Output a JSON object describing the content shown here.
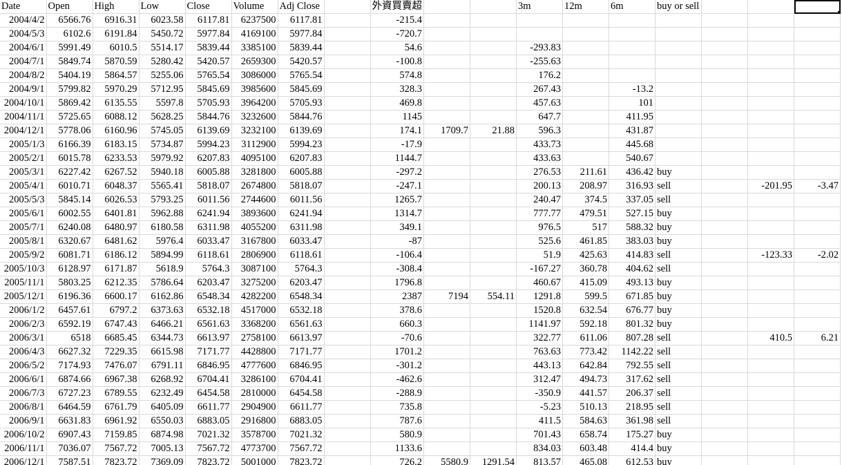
{
  "sheet": {
    "headers": [
      "Date",
      "Open",
      "High",
      "Low",
      "Close",
      "Volume",
      "Adj Close",
      "",
      "外資買賣超",
      "",
      "",
      "3m",
      "12m",
      "6m",
      "buy or sell",
      "",
      "",
      ""
    ],
    "rows": [
      [
        "2004/4/2",
        "6566.76",
        "6916.31",
        "6023.58",
        "6117.81",
        "6237500",
        "6117.81",
        "",
        "-215.4",
        "",
        "",
        "",
        "",
        "",
        "",
        "",
        "",
        ""
      ],
      [
        "2004/5/3",
        "6102.6",
        "6191.84",
        "5450.72",
        "5977.84",
        "4169100",
        "5977.84",
        "",
        "-720.7",
        "",
        "",
        "",
        "",
        "",
        "",
        "",
        "",
        ""
      ],
      [
        "2004/6/1",
        "5991.49",
        "6010.5",
        "5514.17",
        "5839.44",
        "3385100",
        "5839.44",
        "",
        "54.6",
        "",
        "",
        "-293.83",
        "",
        "",
        "",
        "",
        "",
        ""
      ],
      [
        "2004/7/1",
        "5849.74",
        "5870.59",
        "5280.42",
        "5420.57",
        "2659300",
        "5420.57",
        "",
        "-100.8",
        "",
        "",
        "-255.63",
        "",
        "",
        "",
        "",
        "",
        ""
      ],
      [
        "2004/8/2",
        "5404.19",
        "5864.57",
        "5255.06",
        "5765.54",
        "3086000",
        "5765.54",
        "",
        "574.8",
        "",
        "",
        "176.2",
        "",
        "",
        "",
        "",
        "",
        ""
      ],
      [
        "2004/9/1",
        "5799.82",
        "5970.29",
        "5712.95",
        "5845.69",
        "3985600",
        "5845.69",
        "",
        "328.3",
        "",
        "",
        "267.43",
        "",
        "-13.2",
        "",
        "",
        "",
        ""
      ],
      [
        "2004/10/1",
        "5869.42",
        "6135.55",
        "5597.8",
        "5705.93",
        "3964200",
        "5705.93",
        "",
        "469.8",
        "",
        "",
        "457.63",
        "",
        "101",
        "",
        "",
        "",
        ""
      ],
      [
        "2004/11/1",
        "5725.65",
        "6088.12",
        "5628.25",
        "5844.76",
        "3232600",
        "5844.76",
        "",
        "1145",
        "",
        "",
        "647.7",
        "",
        "411.95",
        "",
        "",
        "",
        ""
      ],
      [
        "2004/12/1",
        "5778.06",
        "6160.96",
        "5745.05",
        "6139.69",
        "3232100",
        "6139.69",
        "",
        "174.1",
        "1709.7",
        "21.88",
        "596.3",
        "",
        "431.87",
        "",
        "",
        "",
        ""
      ],
      [
        "2005/1/3",
        "6166.39",
        "6183.15",
        "5734.87",
        "5994.23",
        "3112900",
        "5994.23",
        "",
        "-17.9",
        "",
        "",
        "433.73",
        "",
        "445.68",
        "",
        "",
        "",
        ""
      ],
      [
        "2005/2/1",
        "6015.78",
        "6233.53",
        "5979.92",
        "6207.83",
        "4095100",
        "6207.83",
        "",
        "1144.7",
        "",
        "",
        "433.63",
        "",
        "540.67",
        "",
        "",
        "",
        ""
      ],
      [
        "2005/3/1",
        "6227.42",
        "6267.52",
        "5940.18",
        "6005.88",
        "3281800",
        "6005.88",
        "",
        "-297.2",
        "",
        "",
        "276.53",
        "211.61",
        "436.42",
        "buy",
        "",
        "",
        ""
      ],
      [
        "2005/4/1",
        "6010.71",
        "6048.37",
        "5565.41",
        "5818.07",
        "2674800",
        "5818.07",
        "",
        "-247.1",
        "",
        "",
        "200.13",
        "208.97",
        "316.93",
        "sell",
        "",
        "-201.95",
        "-3.47"
      ],
      [
        "2005/5/3",
        "5845.14",
        "6026.53",
        "5793.25",
        "6011.56",
        "2744600",
        "6011.56",
        "",
        "1265.7",
        "",
        "",
        "240.47",
        "374.5",
        "337.05",
        "sell",
        "",
        "",
        ""
      ],
      [
        "2005/6/1",
        "6002.55",
        "6401.81",
        "5962.88",
        "6241.94",
        "3893600",
        "6241.94",
        "",
        "1314.7",
        "",
        "",
        "777.77",
        "479.51",
        "527.15",
        "buy",
        "",
        "",
        ""
      ],
      [
        "2005/7/1",
        "6240.08",
        "6480.97",
        "6180.58",
        "6311.98",
        "4055200",
        "6311.98",
        "",
        "349.1",
        "",
        "",
        "976.5",
        "517",
        "588.32",
        "buy",
        "",
        "",
        ""
      ],
      [
        "2005/8/1",
        "6320.67",
        "6481.62",
        "5976.4",
        "6033.47",
        "3167800",
        "6033.47",
        "",
        "-87",
        "",
        "",
        "525.6",
        "461.85",
        "383.03",
        "buy",
        "",
        "",
        ""
      ],
      [
        "2005/9/2",
        "6081.71",
        "6186.12",
        "5894.99",
        "6118.61",
        "2806900",
        "6118.61",
        "",
        "-106.4",
        "",
        "",
        "51.9",
        "425.63",
        "414.83",
        "sell",
        "",
        "-123.33",
        "-2.02"
      ],
      [
        "2005/10/3",
        "6128.97",
        "6171.87",
        "5618.9",
        "5764.3",
        "3087100",
        "5764.3",
        "",
        "-308.4",
        "",
        "",
        "-167.27",
        "360.78",
        "404.62",
        "sell",
        "",
        "",
        ""
      ],
      [
        "2005/11/1",
        "5803.25",
        "6212.35",
        "5786.64",
        "6203.47",
        "3275200",
        "6203.47",
        "",
        "1796.8",
        "",
        "",
        "460.67",
        "415.09",
        "493.13",
        "buy",
        "",
        "",
        ""
      ],
      [
        "2005/12/1",
        "6196.36",
        "6600.17",
        "6162.86",
        "6548.34",
        "4282200",
        "6548.34",
        "",
        "2387",
        "7194",
        "554.11",
        "1291.8",
        "599.5",
        "671.85",
        "buy",
        "",
        "",
        ""
      ],
      [
        "2006/1/2",
        "6457.61",
        "6797.2",
        "6373.63",
        "6532.18",
        "4517000",
        "6532.18",
        "",
        "378.6",
        "",
        "",
        "1520.8",
        "632.54",
        "676.77",
        "buy",
        "",
        "",
        ""
      ],
      [
        "2006/2/3",
        "6592.19",
        "6747.43",
        "6466.21",
        "6561.63",
        "3368200",
        "6561.63",
        "",
        "660.3",
        "",
        "",
        "1141.97",
        "592.18",
        "801.32",
        "buy",
        "",
        "",
        ""
      ],
      [
        "2006/3/1",
        "6518",
        "6685.45",
        "6344.73",
        "6613.97",
        "2758100",
        "6613.97",
        "",
        "-70.6",
        "",
        "",
        "322.77",
        "611.06",
        "807.28",
        "sell",
        "",
        "410.5",
        "6.21"
      ],
      [
        "2006/4/3",
        "6627.32",
        "7229.35",
        "6615.98",
        "7171.77",
        "4428800",
        "7171.77",
        "",
        "1701.2",
        "",
        "",
        "763.63",
        "773.42",
        "1142.22",
        "sell",
        "",
        "",
        ""
      ],
      [
        "2006/5/2",
        "7174.93",
        "7476.07",
        "6791.11",
        "6846.95",
        "4777600",
        "6846.95",
        "",
        "-301.2",
        "",
        "",
        "443.13",
        "642.84",
        "792.55",
        "sell",
        "",
        "",
        ""
      ],
      [
        "2006/6/1",
        "6874.66",
        "6967.38",
        "6268.92",
        "6704.41",
        "3286100",
        "6704.41",
        "",
        "-462.6",
        "",
        "",
        "312.47",
        "494.73",
        "317.62",
        "sell",
        "",
        "",
        ""
      ],
      [
        "2006/7/3",
        "6727.23",
        "6789.55",
        "6232.49",
        "6454.58",
        "2810000",
        "6454.58",
        "",
        "-288.9",
        "",
        "",
        "-350.9",
        "441.57",
        "206.37",
        "sell",
        "",
        "",
        ""
      ],
      [
        "2006/8/1",
        "6464.59",
        "6761.79",
        "6405.09",
        "6611.77",
        "2904900",
        "6611.77",
        "",
        "735.8",
        "",
        "",
        "-5.23",
        "510.13",
        "218.95",
        "sell",
        "",
        "",
        ""
      ],
      [
        "2006/9/1",
        "6631.83",
        "6961.92",
        "6550.03",
        "6883.05",
        "2916800",
        "6883.05",
        "",
        "787.6",
        "",
        "",
        "411.5",
        "584.63",
        "361.98",
        "sell",
        "",
        "",
        ""
      ],
      [
        "2006/10/2",
        "6907.43",
        "7159.85",
        "6874.98",
        "7021.32",
        "3578700",
        "7021.32",
        "",
        "580.9",
        "",
        "",
        "701.43",
        "658.74",
        "175.27",
        "buy",
        "",
        "",
        ""
      ],
      [
        "2006/11/1",
        "7036.07",
        "7567.72",
        "7005.13",
        "7567.72",
        "4773700",
        "7567.72",
        "",
        "1133.6",
        "",
        "",
        "834.03",
        "603.48",
        "414.4",
        "buy",
        "",
        "",
        ""
      ],
      [
        "2006/12/1",
        "7587.51",
        "7823.72",
        "7369.09",
        "7823.72",
        "5001000",
        "7823.72",
        "",
        "726.2",
        "5580.9",
        "1291.54",
        "813.57",
        "465.08",
        "612.53",
        "buy",
        "",
        "",
        ""
      ]
    ]
  }
}
